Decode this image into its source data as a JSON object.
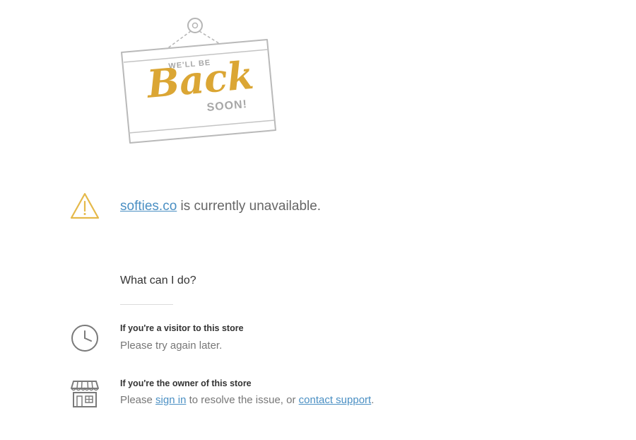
{
  "sign": {
    "top_text": "WE'LL BE",
    "big_text": "Back",
    "bottom_text": "SOON!"
  },
  "main": {
    "store_link": "softies.co",
    "status_text": " is currently unavailable.",
    "what_heading": "What can I do?"
  },
  "visitor": {
    "title": "If you're a visitor to this store",
    "text": "Please try again later."
  },
  "owner": {
    "title": "If you're the owner of this store",
    "text_before": "Please ",
    "sign_in_link": "sign in",
    "text_middle": " to resolve the issue, or ",
    "support_link": "contact support",
    "text_after": "."
  },
  "icons": {
    "warning": "warning-triangle-icon",
    "clock": "clock-icon",
    "store": "storefront-icon"
  },
  "colors": {
    "link": "#4a8fc3",
    "sign_accent": "#dba634",
    "warning_icon": "#e5b94a",
    "icon_gray": "#777777"
  }
}
